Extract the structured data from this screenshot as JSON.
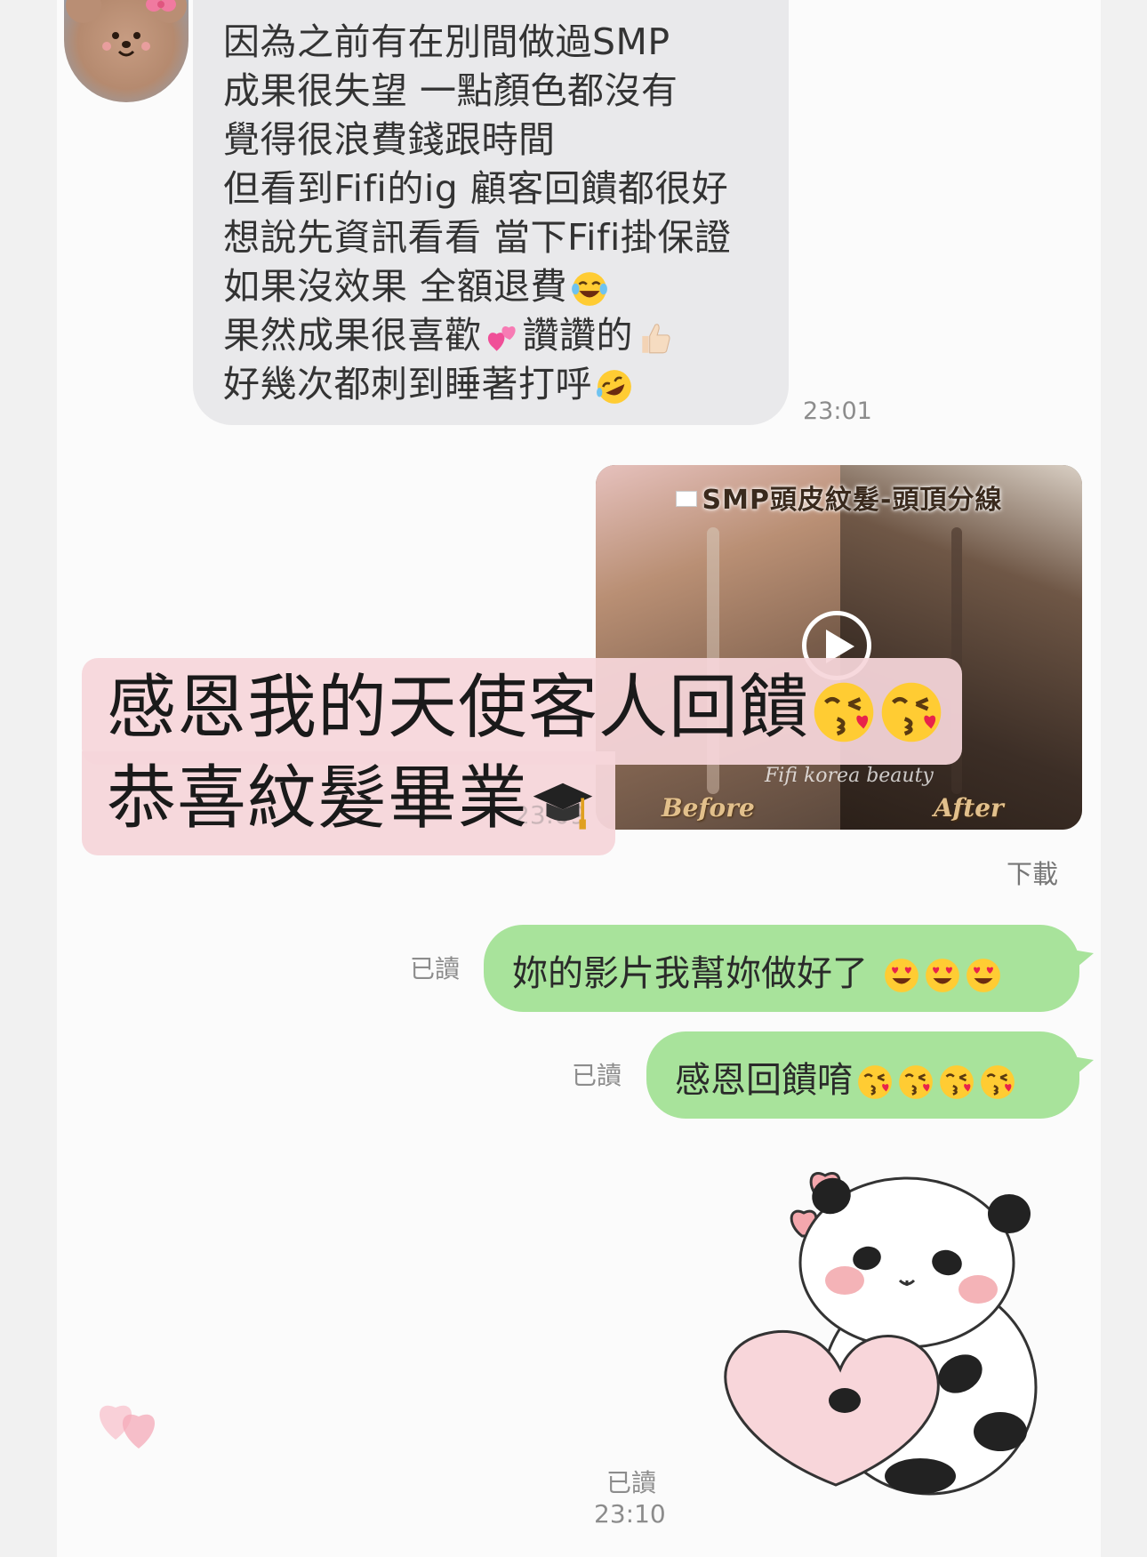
{
  "incoming_message": {
    "lines": [
      "因為之前有在別間做過SMP",
      "成果很失望 一點顏色都沒有",
      "覺得很浪費錢跟時間",
      "但看到Fifi的ig 顧客回饋都很好",
      "想說先資訊看看 當下Fifi掛保證",
      "如果沒效果 全額退費",
      "果然成果很喜歡",
      "讚讚的",
      "好幾次都刺到睡著打呼"
    ],
    "timestamp": "23:01"
  },
  "video_message": {
    "banner": "SMP頭皮紋髮-頭頂分線",
    "before_label": "Before",
    "after_label": "After",
    "watermark": "Fifi korea beauty",
    "ghost_timestamp": "23:09",
    "download_label": "下載"
  },
  "overlay_caption": {
    "line1": "感恩我的天使客人回饋",
    "line2": "恭喜紋髮畢業"
  },
  "outgoing_messages": [
    {
      "text": "妳的影片我幫妳做好了 ",
      "read_label": "已讀"
    },
    {
      "text": "感恩回饋唷",
      "read_label": "已讀"
    }
  ],
  "sticker_message": {
    "read_label": "已讀",
    "timestamp": "23:10"
  },
  "colors": {
    "outgoing_bubble": "#a8e39b",
    "incoming_bubble": "#e9e9eb",
    "overlay_pink": "#f6d6da"
  },
  "icons": [
    "play-icon",
    "laugh-cry-emoji",
    "two-hearts-emoji",
    "thumbs-up-emoji",
    "rofl-emoji",
    "kiss-emoji",
    "heart-eyes-emoji",
    "graduation-cap-emoji",
    "heart-reaction-icon",
    "panda-heart-sticker"
  ]
}
